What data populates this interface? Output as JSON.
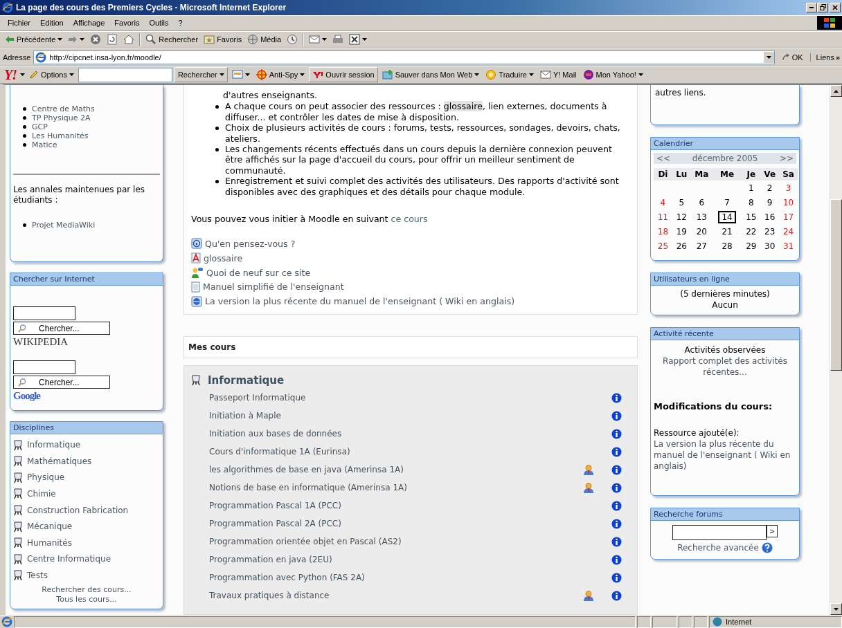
{
  "window": {
    "title": "La page des cours des Premiers Cycles - Microsoft Internet Explorer"
  },
  "menu": [
    "Fichier",
    "Edition",
    "Affichage",
    "Favoris",
    "Outils",
    "?"
  ],
  "toolbar": [
    {
      "kind": "back",
      "label": "Précédente",
      "dropdown": true
    },
    {
      "kind": "forward",
      "dropdown": true
    },
    {
      "kind": "stop",
      "dropdown": false
    },
    {
      "kind": "refresh",
      "dropdown": false
    },
    {
      "kind": "home",
      "dropdown": false
    },
    {
      "kind": "search",
      "label": "Rechercher",
      "dropdown": false
    },
    {
      "kind": "favorites",
      "label": "Favoris",
      "dropdown": false
    },
    {
      "kind": "media",
      "label": "Média",
      "dropdown": false
    },
    {
      "kind": "history",
      "dropdown": false
    },
    {
      "kind": "mail",
      "dropdown": true
    },
    {
      "kind": "print",
      "dropdown": false
    },
    {
      "kind": "edit",
      "dropdown": true
    }
  ],
  "address": {
    "label": "Adresse",
    "url": "http://cipcnet.insa-lyon.fr/moodle/",
    "go": "OK",
    "links": "Liens",
    "more": "»"
  },
  "yahoo_toolbar": {
    "logo": "Y!",
    "items": [
      {
        "kind": "options",
        "label": "Options",
        "dropdown": true
      },
      {
        "kind": "field"
      },
      {
        "kind": "search",
        "label": "Rechercher",
        "dropdown": true
      },
      {
        "kind": "highlight",
        "dropdown": true
      },
      {
        "kind": "antispy",
        "label": "Anti-Spy",
        "dropdown": true
      },
      {
        "kind": "signin",
        "label": "Ouvrir session",
        "dropdown": false
      },
      {
        "kind": "save",
        "label": "Sauver dans Mon Web",
        "dropdown": true
      },
      {
        "kind": "translate",
        "label": "Traduire",
        "dropdown": true
      },
      {
        "kind": "mail",
        "label": "Y! Mail",
        "dropdown": false
      },
      {
        "kind": "myyahoo",
        "label": "Mon Yahoo!",
        "dropdown": true
      }
    ]
  },
  "left": {
    "links_block": {
      "items": [
        "Centre de Maths",
        "TP Physique 2A",
        "GCP",
        "Les Humanités",
        "Matice"
      ],
      "note": "Les annales maintenues par les étudiants :",
      "student_items": [
        "Projet MediaWiki"
      ]
    },
    "web_search": {
      "title": "Chercher sur Internet",
      "engines": [
        {
          "kind": "wikipedia",
          "button": "Chercher...",
          "logo": "WIKIPEDIA"
        },
        {
          "kind": "google",
          "button": "Chercher...",
          "logo": "Google"
        }
      ]
    },
    "disciplines": {
      "title": "Disciplines",
      "items": [
        "Informatique",
        "Mathématiques",
        "Physique",
        "Chimie",
        "Construction Fabrication",
        "Mécanique",
        "Humanités",
        "Centre Informatique",
        "Tests"
      ],
      "links": [
        "Rechercher des cours...",
        "Tous les cours..."
      ]
    }
  },
  "main": {
    "continued_text": "d'autres enseignants.",
    "bullets": [
      {
        "before": "A chaque cours on peut associer des ressources : ",
        "link": "glossaire",
        "after": ", lien externes, documents à diffuser... et contrôler les dates de mise à disposition."
      },
      {
        "before": "Choix de plusieurs activités de cours : forums, tests, ressources, sondages, devoirs, chats, ateliers."
      },
      {
        "before": "Les changements récents effectués dans un cours depuis la dernière connexion peuvent être affichés sur la page d'accueil du cours, pour offrir un meilleur sentiment de communauté."
      },
      {
        "before": "Enregistrement et suivi complet des activités des utilisateurs. Des rapports d'activité sont disponibles avec des graphiques et des détails pour chaque module."
      }
    ],
    "initiation": {
      "text": "Vous pouvez vous initier à Moodle en suivant ",
      "link": "ce cours"
    },
    "resources": [
      {
        "kind": "forum",
        "label": "Qu'en pensez-vous ?"
      },
      {
        "kind": "glossary",
        "label": "glossaire"
      },
      {
        "kind": "news",
        "label": "Quoi de neuf sur ce site"
      },
      {
        "kind": "page",
        "label": "Manuel simplifié de l'enseignant"
      },
      {
        "kind": "web",
        "label": "La version la plus récente du manuel de l'enseignant ( Wiki en anglais)"
      }
    ],
    "my_courses": {
      "title": "Mes cours",
      "category": "Informatique",
      "courses": [
        {
          "name": "Passeport Informatique",
          "teachers": false
        },
        {
          "name": "Initiation à Maple",
          "teachers": false
        },
        {
          "name": "Initiation aux bases de données",
          "teachers": false
        },
        {
          "name": "Cours d'informatique 1A (Eurinsa)",
          "teachers": false
        },
        {
          "name": "les algorithmes de base en java (Amerinsa 1A)",
          "teachers": true
        },
        {
          "name": "Notions de base en informatique (Amerinsa 1A)",
          "teachers": true
        },
        {
          "name": "Programmation Pascal 1A (PCC)",
          "teachers": false
        },
        {
          "name": "Programmation Pascal 2A (PCC)",
          "teachers": false
        },
        {
          "name": "Programmation orientée objet en Pascal (AS2)",
          "teachers": false
        },
        {
          "name": "Programmation en java (2EU)",
          "teachers": false
        },
        {
          "name": "Programmation avec Python (FAS 2A)",
          "teachers": false
        },
        {
          "name": "Travaux pratiques à distance",
          "teachers": true
        }
      ]
    }
  },
  "right": {
    "top_text": "autres liens.",
    "calendar": {
      "title": "Calendrier",
      "prev": "<<",
      "month": "décembre 2005",
      "next": ">>",
      "weekdays": [
        "Di",
        "Lu",
        "Ma",
        "Me",
        "Je",
        "Ve",
        "Sa"
      ],
      "weeks": [
        [
          {
            "day": "1",
            "weekend": false,
            "today": false
          },
          {
            "day": "2",
            "weekend": false,
            "today": false
          },
          {
            "day": "3",
            "weekend": true,
            "today": false
          }
        ],
        [
          {
            "day": "4",
            "weekend": true,
            "today": false
          },
          {
            "day": "5",
            "weekend": false,
            "today": false
          },
          {
            "day": "6",
            "weekend": false,
            "today": false
          },
          {
            "day": "7",
            "weekend": false,
            "today": false
          },
          {
            "day": "8",
            "weekend": false,
            "today": false
          },
          {
            "day": "9",
            "weekend": false,
            "today": false
          },
          {
            "day": "10",
            "weekend": true,
            "today": false
          }
        ],
        [
          {
            "day": "11",
            "weekend": true,
            "today": false
          },
          {
            "day": "12",
            "weekend": false,
            "today": false
          },
          {
            "day": "13",
            "weekend": false,
            "today": false
          },
          {
            "day": "14",
            "weekend": false,
            "today": true
          },
          {
            "day": "15",
            "weekend": false,
            "today": false
          },
          {
            "day": "16",
            "weekend": false,
            "today": false
          },
          {
            "day": "17",
            "weekend": true,
            "today": false
          }
        ],
        [
          {
            "day": "18",
            "weekend": true,
            "today": false
          },
          {
            "day": "19",
            "weekend": false,
            "today": false
          },
          {
            "day": "20",
            "weekend": false,
            "today": false
          },
          {
            "day": "21",
            "weekend": false,
            "today": false
          },
          {
            "day": "22",
            "weekend": false,
            "today": false
          },
          {
            "day": "23",
            "weekend": false,
            "today": false
          },
          {
            "day": "24",
            "weekend": true,
            "today": false
          }
        ],
        [
          {
            "day": "25",
            "weekend": true,
            "today": false
          },
          {
            "day": "26",
            "weekend": false,
            "today": false
          },
          {
            "day": "27",
            "weekend": false,
            "today": false
          },
          {
            "day": "28",
            "weekend": false,
            "today": false
          },
          {
            "day": "29",
            "weekend": false,
            "today": false
          },
          {
            "day": "30",
            "weekend": false,
            "today": false
          },
          {
            "day": "31",
            "weekend": true,
            "today": false
          }
        ]
      ]
    },
    "online": {
      "title": "Utilisateurs en ligne",
      "period": "(5 dernières minutes)",
      "users": "Aucun"
    },
    "activity": {
      "title": "Activité récente",
      "observed": "Activités observées",
      "report_link": "Rapport complet des activités récentes...",
      "changes_title": "Modifications du cours:",
      "change_label": "Ressource ajouté(e):",
      "change_link": "La version la plus récente du manuel de l'enseignant ( Wiki en anglais)"
    },
    "forum_search": {
      "title": "Recherche forums",
      "go": ">",
      "advanced": "Recherche avancée"
    }
  },
  "status_bar": {
    "zone": "Internet"
  }
}
